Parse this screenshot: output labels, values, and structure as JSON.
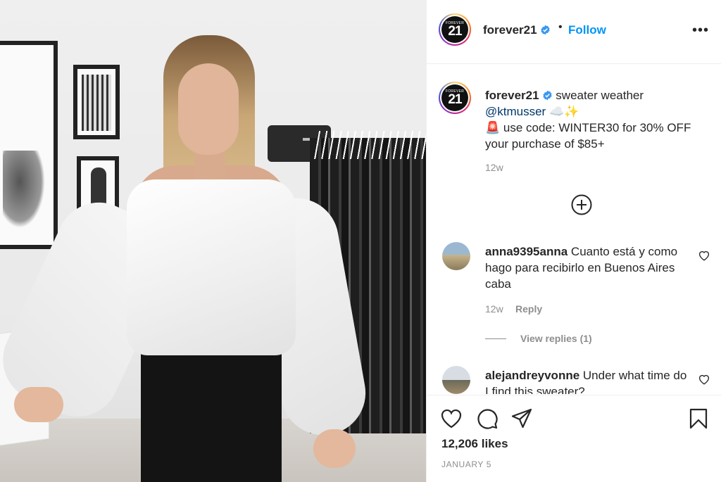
{
  "post": {
    "author": {
      "username": "forever21",
      "avatar_text_top": "FOREVER",
      "avatar_text_main": "21",
      "verified": true
    },
    "header": {
      "separator": "•",
      "follow_label": "Follow",
      "more_label": "•••"
    },
    "caption": {
      "text_line1": "sweater weather",
      "mention": "@ktmusser",
      "emoji_after_mention": "☁️✨",
      "alarm_emoji": "🚨",
      "text_line2": "use code: WINTER30 for 30% OFF your purchase of $85+",
      "time": "12w"
    },
    "comments": [
      {
        "username": "anna9395anna",
        "text": "Cuanto está y como hago para recibirlo en Buenos Aires caba",
        "time": "12w",
        "reply_label": "Reply",
        "view_replies_label": "View replies (1)"
      },
      {
        "username": "alejandreyvonne",
        "text": "Under what time do I find this sweater?"
      }
    ],
    "likes_label": "12,206 likes",
    "date_label": "JANUARY 5"
  },
  "colors": {
    "accent": "#0095f6",
    "text": "#262626",
    "muted": "#8e8e8e",
    "mention": "#00376b",
    "verified": "#3897f0"
  },
  "icons": {
    "like": "heart-icon",
    "comment": "comment-bubble-icon",
    "share": "paper-plane-icon",
    "save": "bookmark-icon",
    "load_more": "plus-circle-icon",
    "more": "ellipsis-icon",
    "verified": "verified-badge-icon"
  }
}
